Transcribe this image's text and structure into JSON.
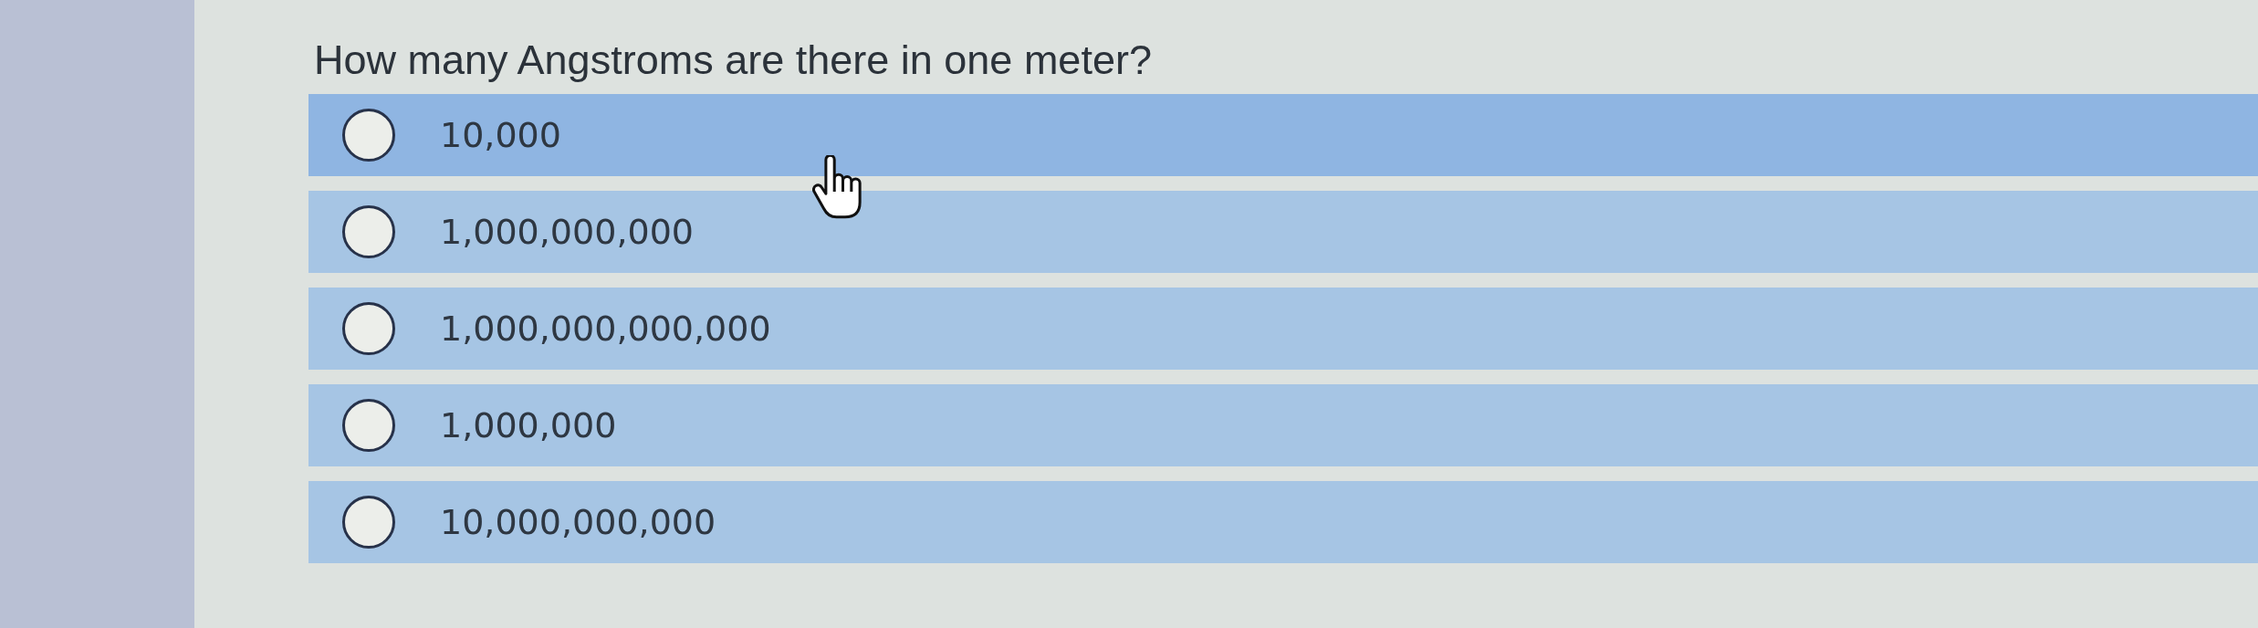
{
  "question": {
    "text": "How many Angstroms are there in one meter?"
  },
  "options": [
    {
      "label": "10,000",
      "selected": false,
      "hovered": true
    },
    {
      "label": "1,000,000,000",
      "selected": false,
      "hovered": false
    },
    {
      "label": "1,000,000,000,000",
      "selected": false,
      "hovered": false
    },
    {
      "label": "1,000,000",
      "selected": false,
      "hovered": false
    },
    {
      "label": "10,000,000,000",
      "selected": false,
      "hovered": false
    }
  ]
}
